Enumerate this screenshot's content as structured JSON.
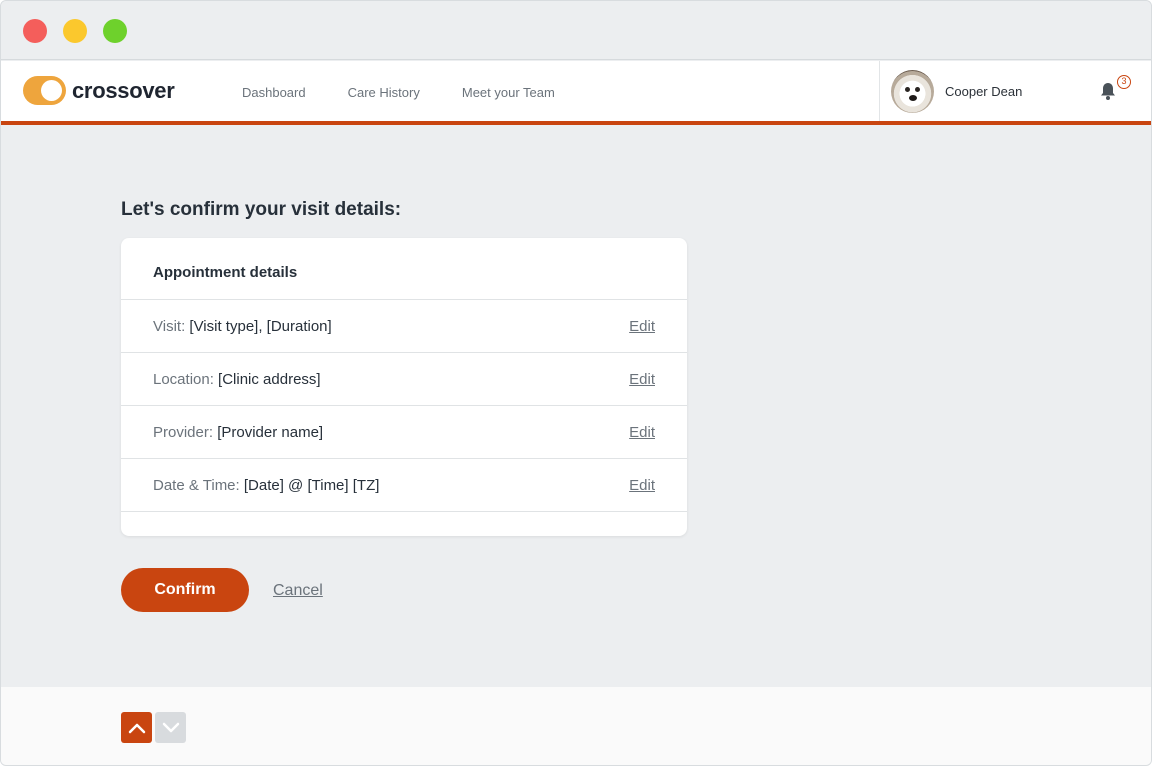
{
  "brand": {
    "name": "crossover",
    "toggle_color": "#eea53d",
    "accent": "#c94510"
  },
  "nav": {
    "links": [
      "Dashboard",
      "Care History",
      "Meet your Team"
    ]
  },
  "user": {
    "name": "Cooper Dean",
    "notification_count": "3"
  },
  "page": {
    "heading": "Let's confirm your visit details:"
  },
  "card": {
    "title": "Appointment details",
    "rows": [
      {
        "label": "Visit:",
        "value": "[Visit type], [Duration]",
        "action": "Edit"
      },
      {
        "label": "Location:",
        "value": "[Clinic address]",
        "action": "Edit"
      },
      {
        "label": "Provider:",
        "value": "[Provider name]",
        "action": "Edit"
      },
      {
        "label": "Date & Time:",
        "value": "[Date] @ [Time] [TZ]",
        "action": "Edit"
      }
    ]
  },
  "actions": {
    "confirm_label": "Confirm",
    "cancel_label": "Cancel"
  },
  "icons": {
    "window_controls": [
      "close-dot",
      "minimize-dot",
      "maximize-dot"
    ],
    "bell": "bell-icon",
    "footer": [
      "chevron-up-icon",
      "chevron-down-icon"
    ]
  }
}
